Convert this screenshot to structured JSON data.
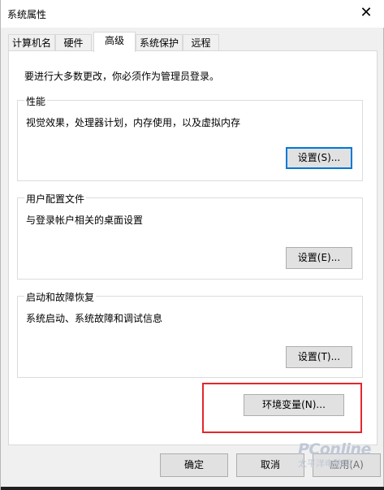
{
  "window": {
    "title": "系统属性",
    "close_glyph": "✕"
  },
  "tabs": [
    {
      "label": "计算机名"
    },
    {
      "label": "硬件"
    },
    {
      "label": "高级",
      "active": true
    },
    {
      "label": "系统保护"
    },
    {
      "label": "远程"
    }
  ],
  "panel": {
    "admin_note": "要进行大多数更改，你必须作为管理员登录。",
    "performance": {
      "title": "性能",
      "description": "视觉效果，处理器计划，内存使用，以及虚拟内存",
      "button": "设置(S)..."
    },
    "user_profiles": {
      "title": "用户配置文件",
      "description": "与登录帐户相关的桌面设置",
      "button": "设置(E)..."
    },
    "startup_recovery": {
      "title": "启动和故障恢复",
      "description": "系统启动、系统故障和调试信息",
      "button": "设置(T)..."
    },
    "env_button": "环境变量(N)..."
  },
  "footer": {
    "ok": "确定",
    "cancel": "取消",
    "apply": "应用(A)"
  },
  "watermark": {
    "logo": "PConline",
    "sub": "太平洋电脑网"
  },
  "colors": {
    "highlight": "#e5262c",
    "focus": "#0078d7"
  },
  "icons": {
    "close": "close-icon"
  }
}
